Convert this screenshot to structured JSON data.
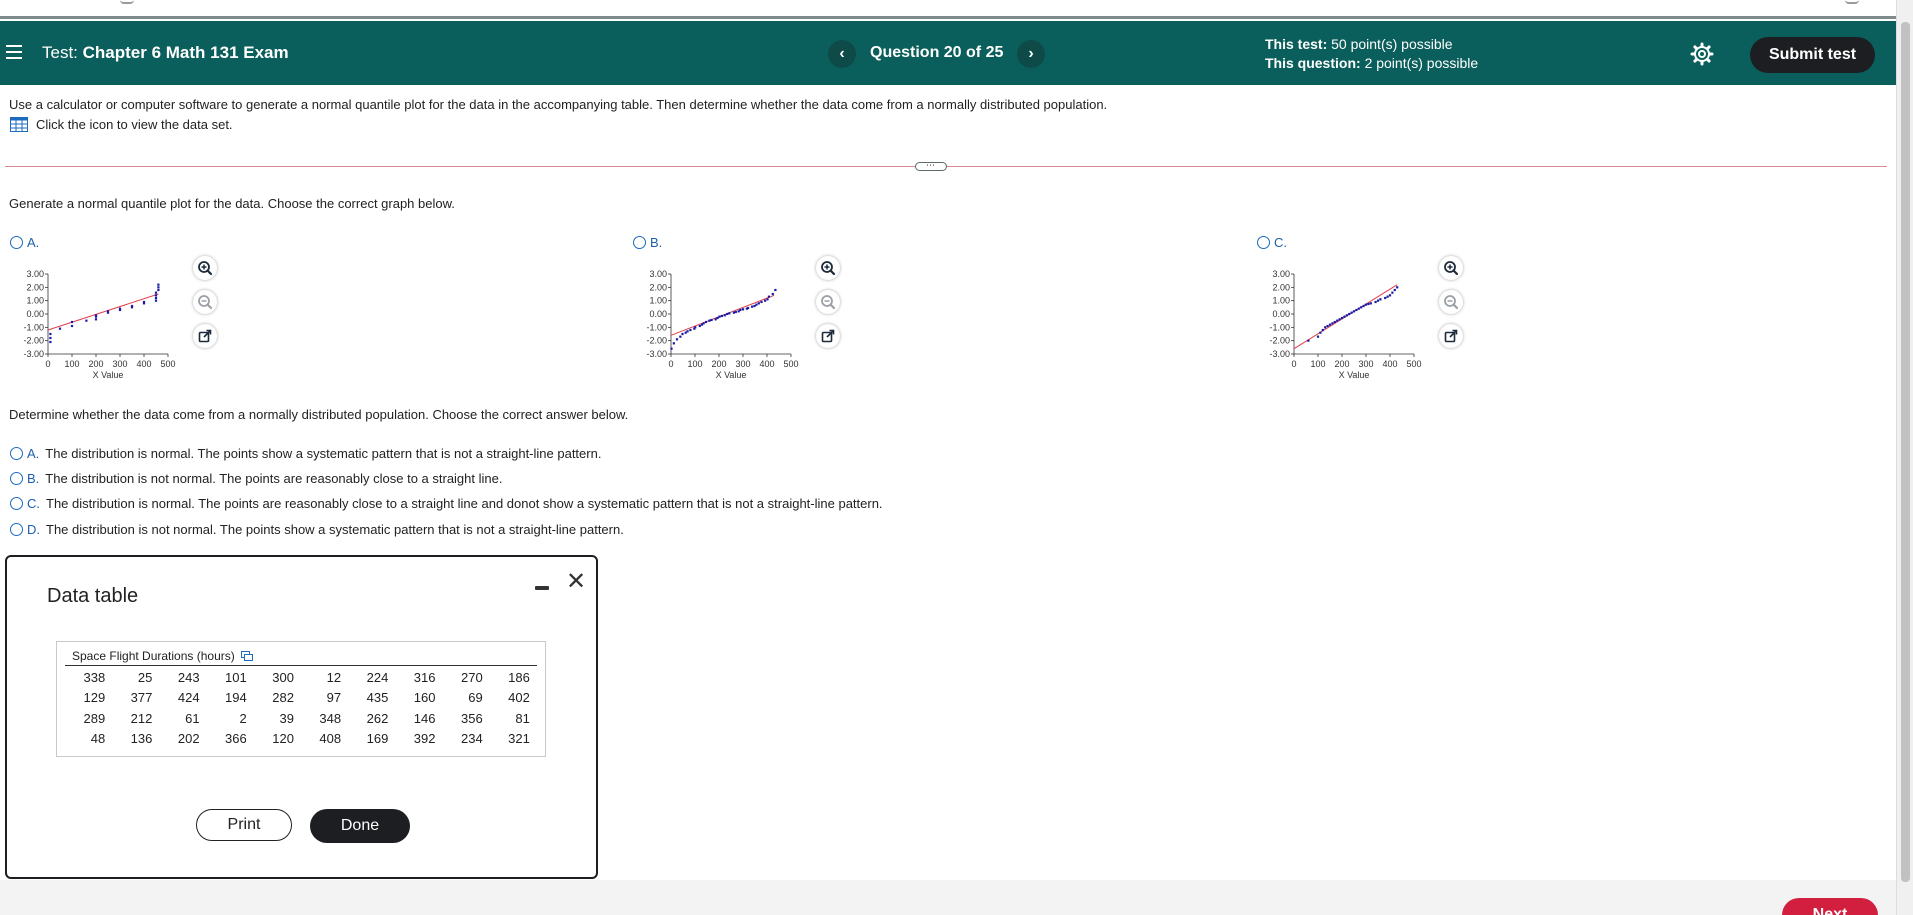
{
  "header": {
    "menu_icon": "hamburger-menu-icon",
    "test_prefix": "Test:",
    "test_name": "Chapter 6 Math 131 Exam",
    "prev_label": "‹",
    "next_label": "›",
    "question_label": "Question 20 of 25",
    "this_test_label": "This test:",
    "this_test_value": "50 point(s) possible",
    "this_question_label": "This question:",
    "this_question_value": "2 point(s) possible",
    "settings_icon": "gear-icon",
    "submit_label": "Submit test",
    "bg_color": "#0a5e5b"
  },
  "question": {
    "instructions": "Use a calculator or computer software to generate a normal quantile plot for the data in the accompanying table. Then determine whether the data come from a normally distributed population.",
    "dataset_link": "Click the icon to view the data set.",
    "divider_handle": "⋯",
    "prompt1": "Generate a normal quantile plot for the data. Choose the correct graph below.",
    "graph_choices": [
      {
        "label": "A."
      },
      {
        "label": "B."
      },
      {
        "label": "C."
      }
    ],
    "prompt2": "Determine whether the data come from a normally distributed population. Choose the correct answer below.",
    "answers": [
      {
        "letter": "A.",
        "text": "The distribution is normal. The points show a systematic pattern that is not a straight-line pattern."
      },
      {
        "letter": "B.",
        "text": "The distribution is not normal. The points are reasonably close to a straight line."
      },
      {
        "letter": "C.",
        "text": "The distribution is normal. The points are reasonably close to a straight line and donot show a systematic pattern that is not a straight-line pattern."
      },
      {
        "letter": "D.",
        "text": "The distribution is not normal. The points show a systematic pattern that is not a  straight-line pattern."
      }
    ],
    "tool_icons": [
      "zoom-in-icon",
      "zoom-out-icon",
      "open-external-icon"
    ]
  },
  "chart_data": [
    {
      "type": "scatter",
      "name": "A.",
      "xlabel": "X Value",
      "xlim": [
        0,
        500
      ],
      "ylim": [
        -3,
        3
      ],
      "x_ticks": [
        "0",
        "100",
        "200",
        "300",
        "400",
        "500"
      ],
      "y_ticks": [
        "3.00",
        "2.00",
        "1.00",
        "0.00",
        "-1.00",
        "-2.00",
        "-3.00"
      ],
      "line": [
        [
          0,
          -1.2
        ],
        [
          460,
          1.5
        ]
      ],
      "points": [
        [
          10,
          -2.1
        ],
        [
          10,
          -1.8
        ],
        [
          10,
          -1.5
        ],
        [
          50,
          -1.1
        ],
        [
          100,
          -0.9
        ],
        [
          100,
          -0.6
        ],
        [
          160,
          -0.5
        ],
        [
          200,
          -0.4
        ],
        [
          200,
          -0.2
        ],
        [
          200,
          -0.1
        ],
        [
          250,
          0.1
        ],
        [
          250,
          0.2
        ],
        [
          300,
          0.3
        ],
        [
          300,
          0.4
        ],
        [
          350,
          0.5
        ],
        [
          350,
          0.6
        ],
        [
          400,
          0.8
        ],
        [
          400,
          0.9
        ],
        [
          450,
          1.0
        ],
        [
          450,
          1.2
        ],
        [
          450,
          1.4
        ],
        [
          450,
          1.6
        ],
        [
          460,
          1.8
        ],
        [
          460,
          2.0
        ],
        [
          460,
          2.2
        ]
      ]
    },
    {
      "type": "scatter",
      "name": "B.",
      "xlabel": "X Value",
      "xlim": [
        0,
        500
      ],
      "ylim": [
        -3,
        3
      ],
      "x_ticks": [
        "0",
        "100",
        "200",
        "300",
        "400",
        "500"
      ],
      "y_ticks": [
        "3.00",
        "2.00",
        "1.00",
        "0.00",
        "-1.00",
        "-2.00",
        "-3.00"
      ],
      "line": [
        [
          0,
          -1.6
        ],
        [
          430,
          1.4
        ]
      ],
      "points": [
        [
          2,
          -2.6
        ],
        [
          12,
          -2.2
        ],
        [
          25,
          -1.9
        ],
        [
          39,
          -1.7
        ],
        [
          48,
          -1.5
        ],
        [
          61,
          -1.4
        ],
        [
          69,
          -1.3
        ],
        [
          81,
          -1.2
        ],
        [
          97,
          -1.1
        ],
        [
          101,
          -1.0
        ],
        [
          120,
          -0.9
        ],
        [
          129,
          -0.8
        ],
        [
          136,
          -0.7
        ],
        [
          146,
          -0.6
        ],
        [
          160,
          -0.5
        ],
        [
          169,
          -0.45
        ],
        [
          186,
          -0.4
        ],
        [
          194,
          -0.3
        ],
        [
          202,
          -0.2
        ],
        [
          212,
          -0.15
        ],
        [
          224,
          -0.1
        ],
        [
          234,
          0.0
        ],
        [
          243,
          0.05
        ],
        [
          262,
          0.1
        ],
        [
          270,
          0.15
        ],
        [
          282,
          0.2
        ],
        [
          289,
          0.3
        ],
        [
          300,
          0.35
        ],
        [
          316,
          0.4
        ],
        [
          321,
          0.45
        ],
        [
          338,
          0.55
        ],
        [
          348,
          0.6
        ],
        [
          356,
          0.7
        ],
        [
          366,
          0.8
        ],
        [
          377,
          0.9
        ],
        [
          392,
          1.0
        ],
        [
          402,
          1.1
        ],
        [
          408,
          1.3
        ],
        [
          424,
          1.5
        ],
        [
          435,
          1.8
        ]
      ]
    },
    {
      "type": "scatter",
      "name": "C.",
      "xlabel": "X Value",
      "xlim": [
        0,
        500
      ],
      "ylim": [
        -3,
        3
      ],
      "x_ticks": [
        "0",
        "100",
        "200",
        "300",
        "400",
        "500"
      ],
      "y_ticks": [
        "3.00",
        "2.00",
        "1.00",
        "0.00",
        "-1.00",
        "-2.00",
        "-3.00"
      ],
      "line": [
        [
          0,
          -2.6
        ],
        [
          430,
          2.2
        ]
      ],
      "points": [
        [
          60,
          -2.0
        ],
        [
          100,
          -1.7
        ],
        [
          110,
          -1.4
        ],
        [
          120,
          -1.2
        ],
        [
          130,
          -1.0
        ],
        [
          140,
          -0.9
        ],
        [
          150,
          -0.8
        ],
        [
          160,
          -0.7
        ],
        [
          170,
          -0.6
        ],
        [
          180,
          -0.5
        ],
        [
          190,
          -0.4
        ],
        [
          200,
          -0.3
        ],
        [
          210,
          -0.2
        ],
        [
          220,
          -0.1
        ],
        [
          230,
          0.0
        ],
        [
          240,
          0.1
        ],
        [
          250,
          0.2
        ],
        [
          260,
          0.3
        ],
        [
          270,
          0.4
        ],
        [
          280,
          0.5
        ],
        [
          290,
          0.6
        ],
        [
          300,
          0.7
        ],
        [
          310,
          0.75
        ],
        [
          320,
          0.8
        ],
        [
          340,
          0.9
        ],
        [
          350,
          1.0
        ],
        [
          360,
          1.1
        ],
        [
          380,
          1.2
        ],
        [
          390,
          1.3
        ],
        [
          400,
          1.4
        ],
        [
          410,
          1.6
        ],
        [
          420,
          1.8
        ],
        [
          430,
          2.0
        ]
      ]
    }
  ],
  "data_table": {
    "title": "Data table",
    "caption": "Space Flight Durations (hours)",
    "rows": [
      [
        "338",
        "25",
        "243",
        "101",
        "300",
        "12",
        "224",
        "316",
        "270",
        "186"
      ],
      [
        "129",
        "377",
        "424",
        "194",
        "282",
        "97",
        "435",
        "160",
        "69",
        "402"
      ],
      [
        "289",
        "212",
        "61",
        "2",
        "39",
        "348",
        "262",
        "146",
        "356",
        "81"
      ],
      [
        "48",
        "136",
        "202",
        "366",
        "120",
        "408",
        "169",
        "392",
        "234",
        "321"
      ]
    ],
    "print_label": "Print",
    "done_label": "Done",
    "minimize_icon": "minimize-icon",
    "close_icon": "close-icon",
    "close_glyph": "✕"
  },
  "footer": {
    "next_label": "Next"
  }
}
